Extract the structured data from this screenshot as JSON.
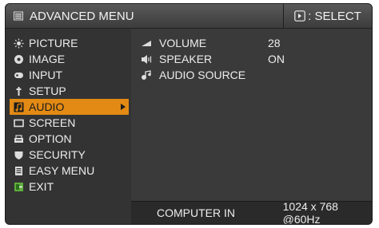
{
  "header": {
    "title": "ADVANCED MENU",
    "title_icon": "menu-icon",
    "select_label": ": SELECT",
    "select_icon": "select-key-icon"
  },
  "menu": {
    "items": [
      {
        "label": "PICTURE",
        "icon": "sun-icon"
      },
      {
        "label": "IMAGE",
        "icon": "image-icon"
      },
      {
        "label": "INPUT",
        "icon": "input-icon"
      },
      {
        "label": "SETUP",
        "icon": "setup-icon"
      },
      {
        "label": "AUDIO",
        "icon": "music-note-icon",
        "selected": true
      },
      {
        "label": "SCREEN",
        "icon": "screen-icon"
      },
      {
        "label": "OPTION",
        "icon": "option-icon"
      },
      {
        "label": "SECURITY",
        "icon": "shield-icon"
      },
      {
        "label": "EASY MENU",
        "icon": "easy-menu-icon"
      },
      {
        "label": "EXIT",
        "icon": "exit-icon"
      }
    ]
  },
  "submenu": {
    "items": [
      {
        "label": "VOLUME",
        "value": "28",
        "icon": "volume-icon"
      },
      {
        "label": "SPEAKER",
        "value": "ON",
        "icon": "speaker-icon"
      },
      {
        "label": "AUDIO SOURCE",
        "value": "",
        "icon": "audio-source-icon"
      }
    ]
  },
  "footer": {
    "source": "COMPUTER IN",
    "signal": "1024 x 768 @60Hz"
  },
  "colors": {
    "background": "#333333",
    "selected": "#e38a14",
    "text": "#ededed"
  }
}
